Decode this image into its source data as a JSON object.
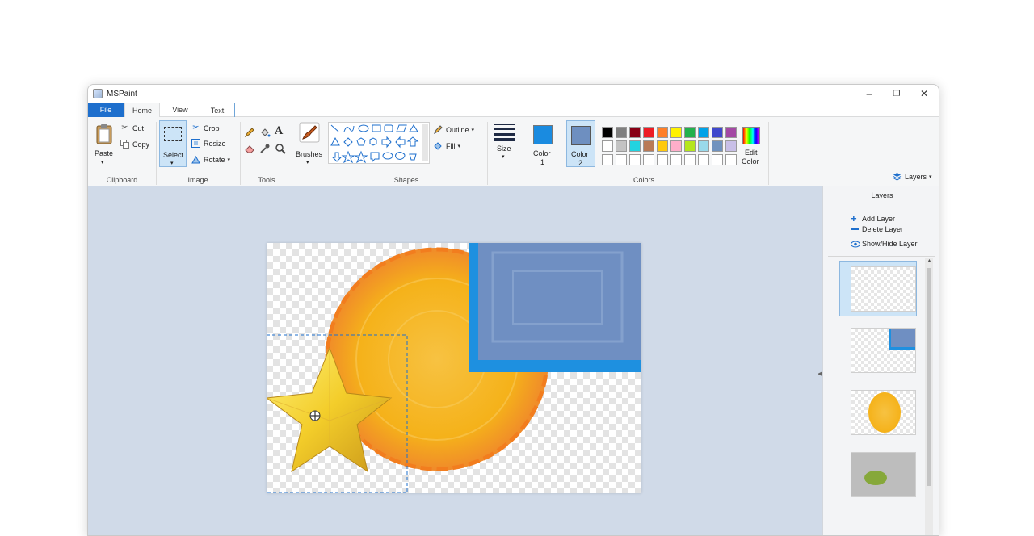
{
  "window": {
    "title": "MSPaint"
  },
  "tabs": [
    {
      "label": "File"
    },
    {
      "label": "Home"
    },
    {
      "label": "View"
    },
    {
      "label": "Text"
    }
  ],
  "ribbon": {
    "clipboard": {
      "label": "Clipboard",
      "paste": "Paste",
      "cut": "Cut",
      "copy": "Copy"
    },
    "image": {
      "label": "Image",
      "select": "Select",
      "crop": "Crop",
      "resize": "Resize",
      "rotate": "Rotate"
    },
    "tools": {
      "label": "Tools"
    },
    "brushes": {
      "label": "Brushes"
    },
    "shapes": {
      "label": "Shapes",
      "outline": "Outline",
      "fill": "Fill"
    },
    "size": {
      "label": "Size"
    },
    "colors": {
      "label": "Colors",
      "color1_label": "Color",
      "color1_num": "1",
      "color2_label": "Color",
      "color2_num": "2",
      "color1_value": "#1a8be0",
      "color2_value": "#6e8fc0",
      "edit_label_1": "Edit",
      "edit_label_2": "Color",
      "palette_row1": [
        "#000000",
        "#7f7f7f",
        "#880015",
        "#ed1c24",
        "#ff7f27",
        "#fff200",
        "#22b14c",
        "#00a2e8",
        "#3f48cc",
        "#a349a4"
      ],
      "palette_row2": [
        "#ffffff",
        "#c3c3c3",
        "#22d3e0",
        "#b97a57",
        "#ffc90e",
        "#ffaec9",
        "#b5e61d",
        "#99d9ea",
        "#7092be",
        "#c8bfe7"
      ],
      "palette_row3": [
        "#ffffff",
        "#ffffff",
        "#ffffff",
        "#ffffff",
        "#ffffff",
        "#ffffff",
        "#ffffff",
        "#ffffff",
        "#ffffff",
        "#ffffff"
      ]
    },
    "layers_button": "Layers"
  },
  "panel": {
    "title": "Layers",
    "add": "Add Layer",
    "delete": "Delete Layer",
    "toggle": "Show/Hide Layer"
  },
  "icons": [
    "paste-icon",
    "cut-icon",
    "copy-icon",
    "select-icon",
    "crop-icon",
    "resize-icon",
    "rotate-icon",
    "pencil-icon",
    "fill-bucket-icon",
    "text-icon",
    "eraser-icon",
    "color-picker-icon",
    "magnifier-icon",
    "brush-icon",
    "outline-icon",
    "fill-icon",
    "size-icon",
    "edit-color-icon",
    "layers-icon",
    "add-icon",
    "delete-icon",
    "eye-icon",
    "move-cursor-icon"
  ]
}
